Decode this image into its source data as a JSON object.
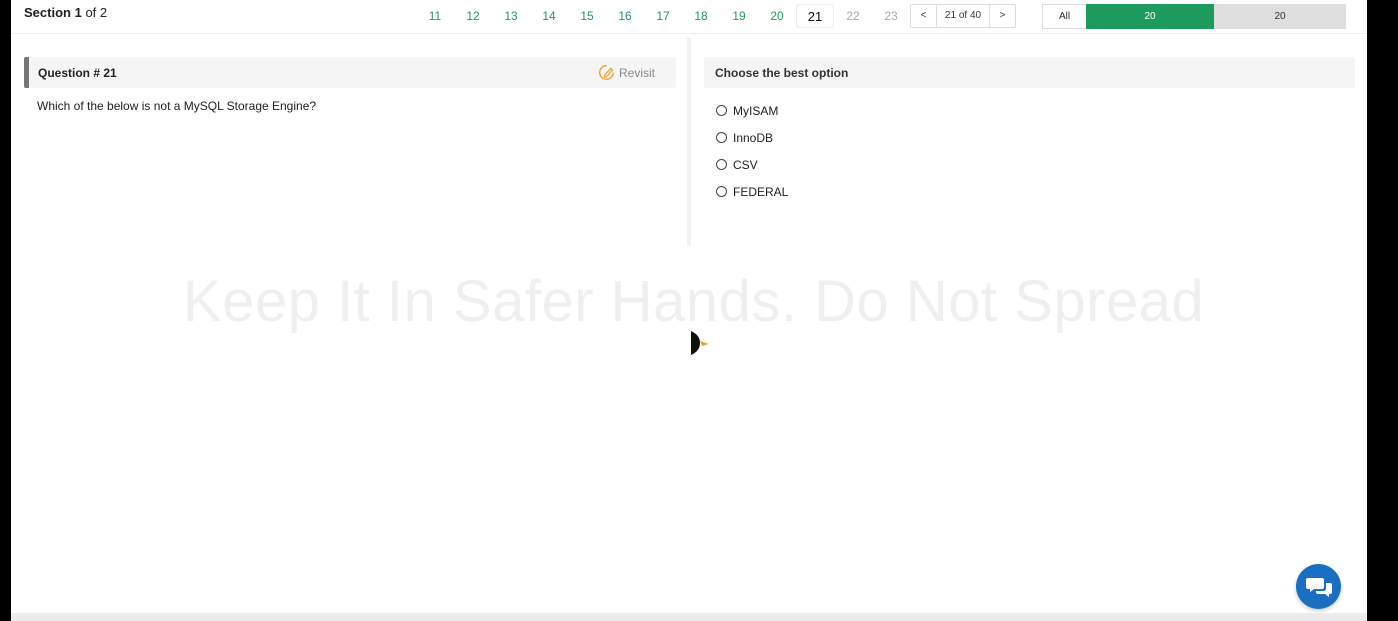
{
  "header": {
    "section_word": "Section",
    "section_current": "1",
    "section_of": "of 2",
    "question_numbers": [
      {
        "label": "11",
        "state": "answered"
      },
      {
        "label": "12",
        "state": "answered"
      },
      {
        "label": "13",
        "state": "answered"
      },
      {
        "label": "14",
        "state": "answered"
      },
      {
        "label": "15",
        "state": "answered"
      },
      {
        "label": "16",
        "state": "answered"
      },
      {
        "label": "17",
        "state": "answered"
      },
      {
        "label": "18",
        "state": "answered"
      },
      {
        "label": "19",
        "state": "answered"
      },
      {
        "label": "20",
        "state": "answered"
      },
      {
        "label": "21",
        "state": "current"
      },
      {
        "label": "22",
        "state": "future"
      },
      {
        "label": "23",
        "state": "future"
      }
    ],
    "pager": {
      "prev": "<",
      "count": "21 of 40",
      "next": ">"
    },
    "filter": {
      "all": "All",
      "answered": "20",
      "unanswered": "20"
    }
  },
  "question": {
    "title": "Question # 21",
    "revisit_label": "Revisit",
    "text": "Which of the below is not a MySQL Storage Engine?"
  },
  "options_panel": {
    "title": "Choose the best option",
    "options": [
      "MyISAM",
      "InnoDB",
      "CSV",
      "FEDERAL"
    ]
  },
  "watermark": "Keep It In Safer Hands. Do Not Spread",
  "colors": {
    "accent_green": "#1d9b5e",
    "chat_blue": "#1a6fc2",
    "revisit_orange": "#f0a030"
  },
  "icons": {
    "revisit": "edit-pencil-icon",
    "chat": "chat-bubbles-icon",
    "cursor": "mouse-pointer-icon"
  }
}
